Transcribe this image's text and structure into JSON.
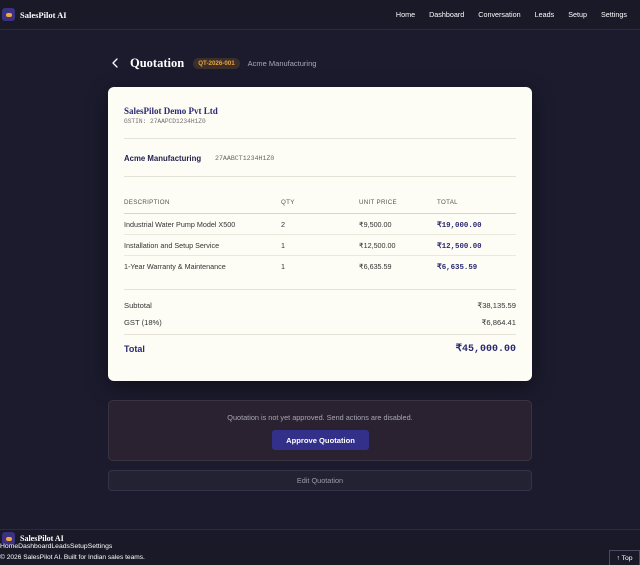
{
  "app": {
    "brand": "SalesPilot AI",
    "nav": [
      "Home",
      "Dashboard",
      "Conversation",
      "Leads",
      "Setup",
      "Settings"
    ]
  },
  "header": {
    "title": "Quotation",
    "quote_id": "QT-2026-001",
    "client": "Acme Manufacturing"
  },
  "quotation": {
    "seller": {
      "name": "SalesPilot Demo Pvt Ltd",
      "gstin": "GSTIN: 27AAPCD1234H1Z0"
    },
    "buyer": {
      "name": "Acme Manufacturing",
      "gstin": "27AABCT1234H1Z0"
    },
    "columns": [
      "DESCRIPTION",
      "QTY",
      "UNIT PRICE",
      "TOTAL"
    ],
    "items": [
      {
        "description": "Industrial Water Pump Model X500",
        "qty": "2",
        "unit_price": "₹9,500.00",
        "total": "₹19,000.00"
      },
      {
        "description": "Installation and Setup Service",
        "qty": "1",
        "unit_price": "₹12,500.00",
        "total": "₹12,500.00"
      },
      {
        "description": "1-Year Warranty & Maintenance",
        "qty": "1",
        "unit_price": "₹6,635.59",
        "total": "₹6,635.59"
      }
    ],
    "subtotal_label": "Subtotal",
    "subtotal": "₹38,135.59",
    "gst_label": "GST (18%)",
    "gst": "₹6,864.41",
    "total_label": "Total",
    "total": "₹45,000.00"
  },
  "approval": {
    "notice": "Quotation is not yet approved. Send actions are disabled.",
    "approve_label": "Approve Quotation",
    "edit_label": "Edit Quotation"
  },
  "footer": {
    "brand": "SalesPilot AI",
    "links": [
      "Home",
      "Dashboard",
      "Leads",
      "Setup",
      "Settings"
    ],
    "copyright": "© 2026 SalesPilot AI. Built for Indian sales teams.",
    "top_label": "↑ Top"
  },
  "colors": {
    "accent": "#33308a",
    "badge": "#f1a43a",
    "background": "#1c1b2e",
    "card": "#fdfcf5"
  }
}
